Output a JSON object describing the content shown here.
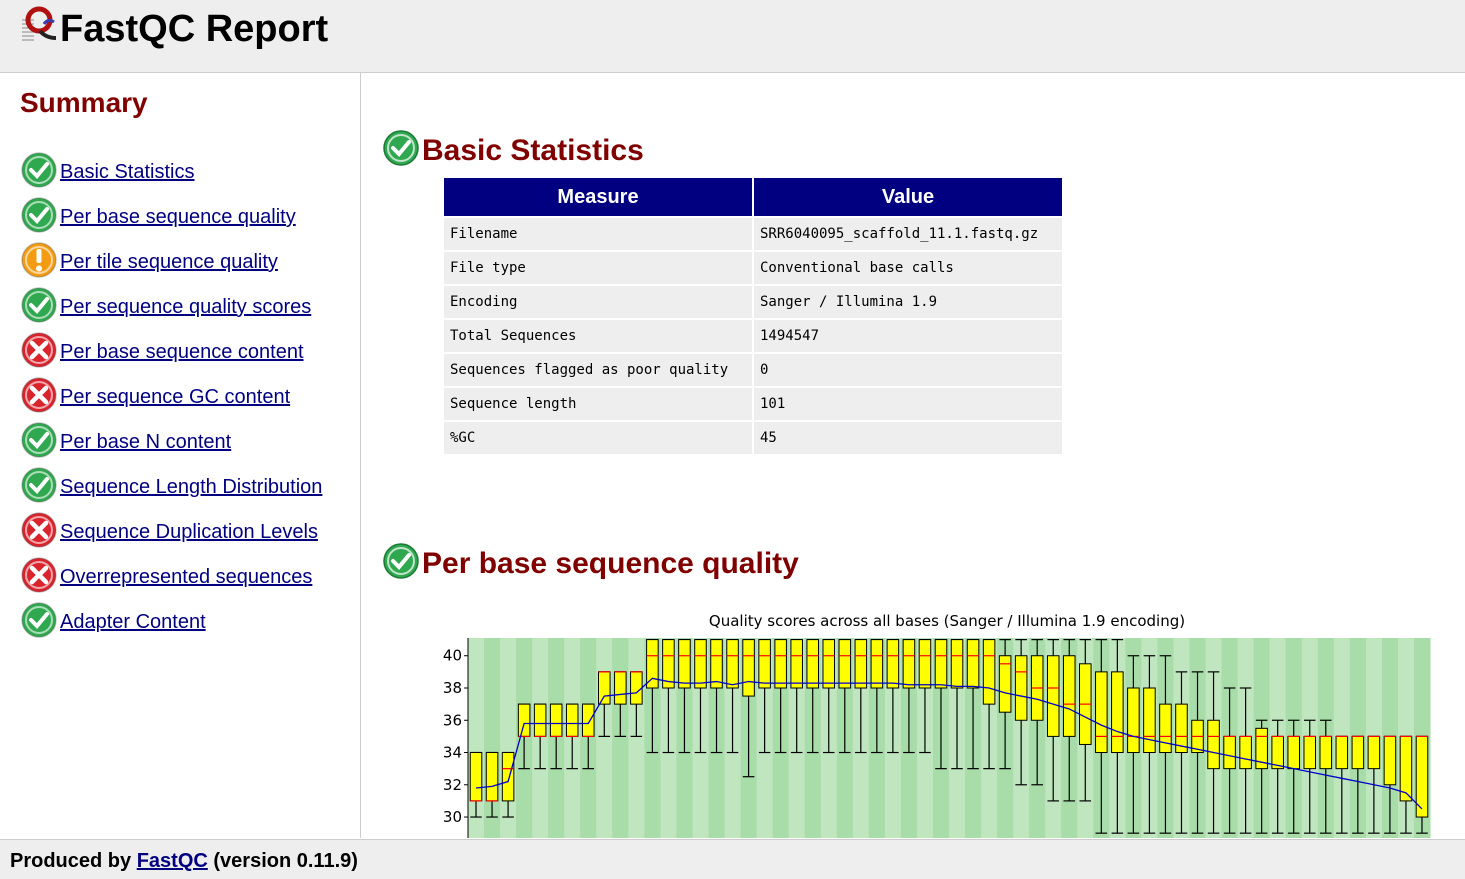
{
  "header": {
    "title": "FastQC Report",
    "logo_icon": "fastqc-logo-icon"
  },
  "summary": {
    "title": "Summary",
    "items": [
      {
        "label": "Basic Statistics",
        "status": "pass"
      },
      {
        "label": "Per base sequence quality",
        "status": "pass"
      },
      {
        "label": "Per tile sequence quality",
        "status": "warn"
      },
      {
        "label": "Per sequence quality scores",
        "status": "pass"
      },
      {
        "label": "Per base sequence content",
        "status": "fail"
      },
      {
        "label": "Per sequence GC content",
        "status": "fail"
      },
      {
        "label": "Per base N content",
        "status": "pass"
      },
      {
        "label": "Sequence Length Distribution",
        "status": "pass"
      },
      {
        "label": "Sequence Duplication Levels",
        "status": "fail"
      },
      {
        "label": "Overrepresented sequences",
        "status": "fail"
      },
      {
        "label": "Adapter Content",
        "status": "pass"
      }
    ]
  },
  "colors": {
    "pass": "#2fa84f",
    "warn": "#f39c12",
    "fail": "#d9232d",
    "title": "#800000",
    "link": "#000080",
    "table_header": "#000080"
  },
  "basic_statistics": {
    "title": "Basic Statistics",
    "status": "pass",
    "columns": [
      "Measure",
      "Value"
    ],
    "rows": [
      [
        "Filename",
        "SRR6040095_scaffold_11.1.fastq.gz"
      ],
      [
        "File type",
        "Conventional base calls"
      ],
      [
        "Encoding",
        "Sanger / Illumina 1.9"
      ],
      [
        "Total Sequences",
        "1494547"
      ],
      [
        "Sequences flagged as poor quality",
        "0"
      ],
      [
        "Sequence length",
        "101"
      ],
      [
        "%GC",
        "45"
      ]
    ]
  },
  "per_base_quality": {
    "title": "Per base sequence quality",
    "status": "pass"
  },
  "chart_data": {
    "type": "box",
    "title": "Quality scores across all bases (Sanger / Illumina 1.9 encoding)",
    "xlabel": "",
    "ylabel": "",
    "ylim": [
      28.7,
      41.1
    ],
    "yticks": [
      30,
      32,
      34,
      36,
      38,
      40
    ],
    "grid": "alternating green stripes",
    "boxes": [
      {
        "q1": 31,
        "q3": 34,
        "median": 31,
        "lw": 30,
        "uw": 34
      },
      {
        "q1": 31,
        "q3": 34,
        "median": 31,
        "lw": 30,
        "uw": 34
      },
      {
        "q1": 31,
        "q3": 34,
        "median": 33,
        "lw": 30,
        "uw": 34
      },
      {
        "q1": 35,
        "q3": 37,
        "median": 35,
        "lw": 33,
        "uw": 37
      },
      {
        "q1": 35,
        "q3": 37,
        "median": 35,
        "lw": 33,
        "uw": 37
      },
      {
        "q1": 35,
        "q3": 37,
        "median": 35,
        "lw": 33,
        "uw": 37
      },
      {
        "q1": 35,
        "q3": 37,
        "median": 35,
        "lw": 33,
        "uw": 37
      },
      {
        "q1": 35,
        "q3": 37,
        "median": 35,
        "lw": 33,
        "uw": 37
      },
      {
        "q1": 37,
        "q3": 39,
        "median": 39,
        "lw": 35,
        "uw": 39
      },
      {
        "q1": 37,
        "q3": 39,
        "median": 39,
        "lw": 35,
        "uw": 39
      },
      {
        "q1": 37,
        "q3": 39,
        "median": 39,
        "lw": 35,
        "uw": 39
      },
      {
        "q1": 38,
        "q3": 41,
        "median": 40,
        "lw": 34,
        "uw": 41
      },
      {
        "q1": 38,
        "q3": 41,
        "median": 40,
        "lw": 34,
        "uw": 41
      },
      {
        "q1": 38,
        "q3": 41,
        "median": 40,
        "lw": 34,
        "uw": 41
      },
      {
        "q1": 38,
        "q3": 41,
        "median": 40,
        "lw": 34,
        "uw": 41
      },
      {
        "q1": 38,
        "q3": 41,
        "median": 40,
        "lw": 34,
        "uw": 41
      },
      {
        "q1": 38,
        "q3": 41,
        "median": 40,
        "lw": 34,
        "uw": 41
      },
      {
        "q1": 37.5,
        "q3": 41,
        "median": 40,
        "lw": 32.5,
        "uw": 41
      },
      {
        "q1": 38,
        "q3": 41,
        "median": 40,
        "lw": 34,
        "uw": 41
      },
      {
        "q1": 38,
        "q3": 41,
        "median": 40,
        "lw": 34,
        "uw": 41
      },
      {
        "q1": 38,
        "q3": 41,
        "median": 40,
        "lw": 34,
        "uw": 41
      },
      {
        "q1": 38,
        "q3": 41,
        "median": 40,
        "lw": 34,
        "uw": 41
      },
      {
        "q1": 38,
        "q3": 41,
        "median": 40,
        "lw": 34,
        "uw": 41
      },
      {
        "q1": 38,
        "q3": 41,
        "median": 40,
        "lw": 34,
        "uw": 41
      },
      {
        "q1": 38,
        "q3": 41,
        "median": 40,
        "lw": 34,
        "uw": 41
      },
      {
        "q1": 38,
        "q3": 41,
        "median": 40,
        "lw": 34,
        "uw": 41
      },
      {
        "q1": 38,
        "q3": 41,
        "median": 40,
        "lw": 34,
        "uw": 41
      },
      {
        "q1": 38,
        "q3": 41,
        "median": 40,
        "lw": 34,
        "uw": 41
      },
      {
        "q1": 38,
        "q3": 41,
        "median": 40,
        "lw": 34,
        "uw": 41
      },
      {
        "q1": 38,
        "q3": 41,
        "median": 40,
        "lw": 33,
        "uw": 41
      },
      {
        "q1": 38,
        "q3": 41,
        "median": 40,
        "lw": 33,
        "uw": 41
      },
      {
        "q1": 38,
        "q3": 41,
        "median": 40,
        "lw": 33,
        "uw": 41
      },
      {
        "q1": 37,
        "q3": 41,
        "median": 40,
        "lw": 33,
        "uw": 41
      },
      {
        "q1": 36.5,
        "q3": 40,
        "median": 39.5,
        "lw": 33,
        "uw": 41
      },
      {
        "q1": 36,
        "q3": 40,
        "median": 39,
        "lw": 32,
        "uw": 41
      },
      {
        "q1": 36,
        "q3": 40,
        "median": 38,
        "lw": 32,
        "uw": 41
      },
      {
        "q1": 35,
        "q3": 40,
        "median": 38,
        "lw": 31,
        "uw": 41
      },
      {
        "q1": 35,
        "q3": 40,
        "median": 37,
        "lw": 31,
        "uw": 41
      },
      {
        "q1": 34.5,
        "q3": 39.5,
        "median": 37,
        "lw": 31,
        "uw": 41
      },
      {
        "q1": 34,
        "q3": 39,
        "median": 35,
        "lw": 29,
        "uw": 41
      },
      {
        "q1": 34,
        "q3": 39,
        "median": 35,
        "lw": 29,
        "uw": 41
      },
      {
        "q1": 34,
        "q3": 38,
        "median": 35,
        "lw": 29,
        "uw": 40
      },
      {
        "q1": 34,
        "q3": 38,
        "median": 35,
        "lw": 29,
        "uw": 40
      },
      {
        "q1": 34,
        "q3": 37,
        "median": 35,
        "lw": 29,
        "uw": 40
      },
      {
        "q1": 34,
        "q3": 37,
        "median": 35,
        "lw": 29,
        "uw": 39
      },
      {
        "q1": 34,
        "q3": 36,
        "median": 35,
        "lw": 29,
        "uw": 39
      },
      {
        "q1": 33,
        "q3": 36,
        "median": 35,
        "lw": 29,
        "uw": 39
      },
      {
        "q1": 33,
        "q3": 35,
        "median": 35,
        "lw": 29,
        "uw": 38
      },
      {
        "q1": 33,
        "q3": 35,
        "median": 35,
        "lw": 29,
        "uw": 38
      },
      {
        "q1": 33,
        "q3": 35.5,
        "median": 35,
        "lw": 29,
        "uw": 36
      },
      {
        "q1": 33,
        "q3": 35,
        "median": 35,
        "lw": 29,
        "uw": 36
      },
      {
        "q1": 33,
        "q3": 35,
        "median": 35,
        "lw": 29,
        "uw": 36
      },
      {
        "q1": 33,
        "q3": 35,
        "median": 35,
        "lw": 29,
        "uw": 36
      },
      {
        "q1": 33,
        "q3": 35,
        "median": 35,
        "lw": 29,
        "uw": 36
      },
      {
        "q1": 33,
        "q3": 35,
        "median": 35,
        "lw": 29,
        "uw": 35
      },
      {
        "q1": 33,
        "q3": 35,
        "median": 35,
        "lw": 29,
        "uw": 35
      },
      {
        "q1": 33,
        "q3": 35,
        "median": 35,
        "lw": 29,
        "uw": 35
      },
      {
        "q1": 32,
        "q3": 35,
        "median": 35,
        "lw": 29,
        "uw": 35
      },
      {
        "q1": 31,
        "q3": 35,
        "median": 35,
        "lw": 29,
        "uw": 35
      },
      {
        "q1": 30,
        "q3": 35,
        "median": 35,
        "lw": 29,
        "uw": 35
      }
    ],
    "mean": [
      31.8,
      31.9,
      32.2,
      35.8,
      35.8,
      35.8,
      35.8,
      35.8,
      37.5,
      37.6,
      37.7,
      38.6,
      38.4,
      38.3,
      38.3,
      38.4,
      38.2,
      38.4,
      38.3,
      38.3,
      38.3,
      38.3,
      38.3,
      38.3,
      38.3,
      38.3,
      38.3,
      38.2,
      38.2,
      38.2,
      38.1,
      38.1,
      38.0,
      37.7,
      37.5,
      37.3,
      37.0,
      36.7,
      36.2,
      35.7,
      35.3,
      35.0,
      34.8,
      34.6,
      34.4,
      34.2,
      34.0,
      33.8,
      33.6,
      33.4,
      33.2,
      33.0,
      32.8,
      32.6,
      32.4,
      32.2,
      32.0,
      31.8,
      31.5,
      30.5
    ]
  },
  "footer": {
    "prefix": "Produced by ",
    "link": "FastQC",
    "suffix": " (version 0.11.9)"
  }
}
